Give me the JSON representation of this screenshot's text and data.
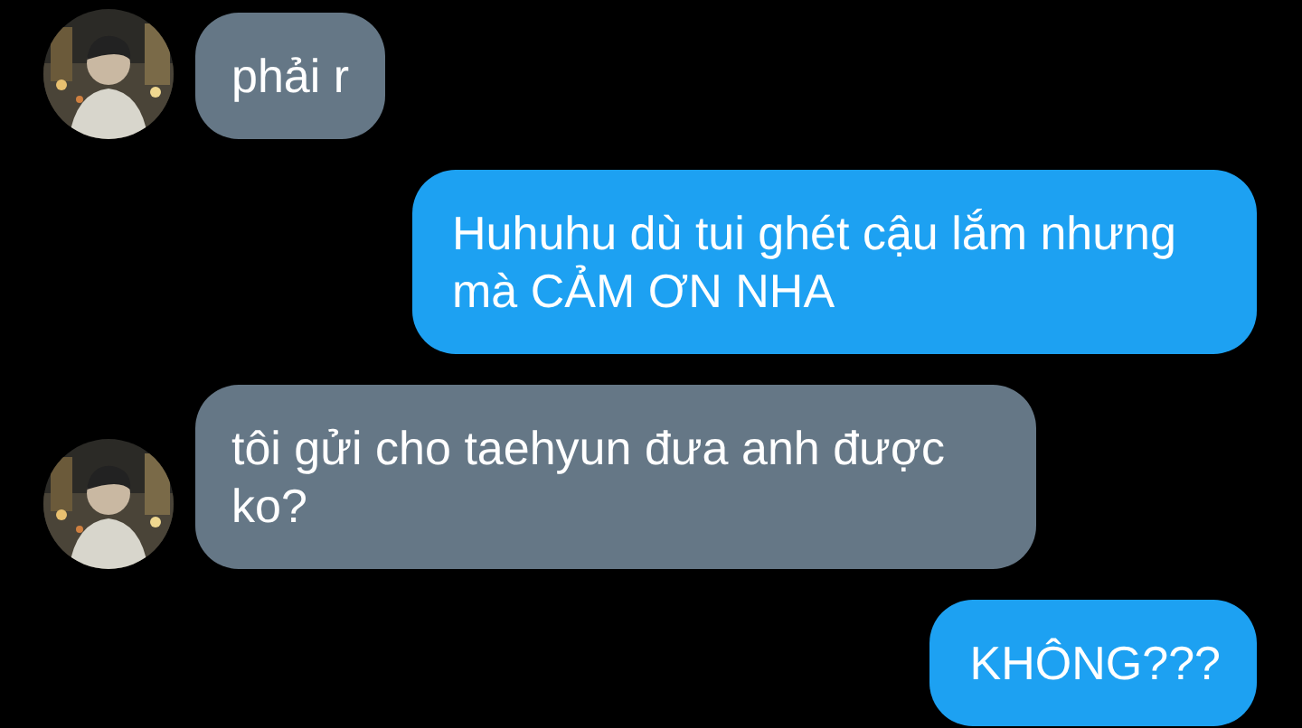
{
  "messages": [
    {
      "kind": "incoming",
      "text": "phải r",
      "avatar": true
    },
    {
      "kind": "outgoing",
      "text": "Huhuhu dù tui ghét cậu lắm nhưng mà CẢM ƠN NHA"
    },
    {
      "kind": "incoming",
      "text": "tôi gửi cho taehyun đưa anh được ko?",
      "avatar": true
    },
    {
      "kind": "outgoing",
      "text": "KHÔNG???"
    }
  ]
}
